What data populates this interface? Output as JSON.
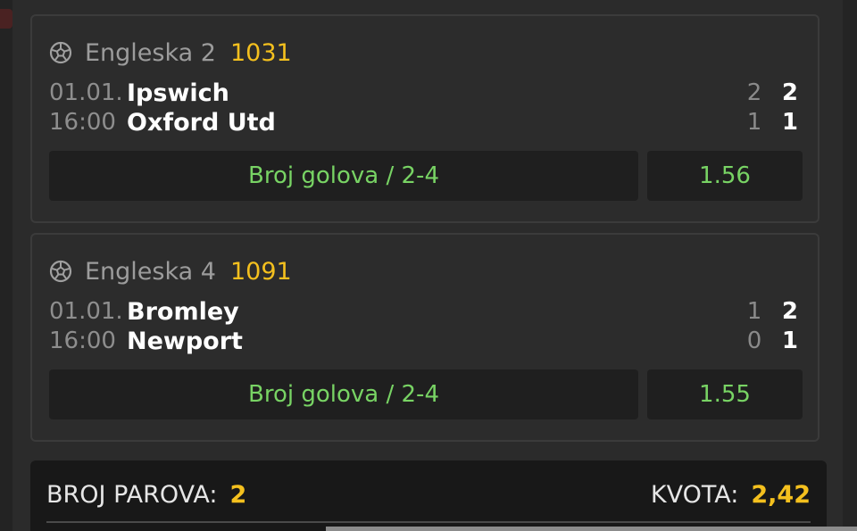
{
  "matches": [
    {
      "league": "Engleska 2",
      "code": "1031",
      "date": "01.01.",
      "time": "16:00",
      "home": "Ipswich",
      "away": "Oxford Utd",
      "home_half": "2",
      "home_final": "2",
      "away_half": "1",
      "away_final": "1",
      "pick": "Broj golova / 2-4",
      "odd": "1.56"
    },
    {
      "league": "Engleska 4",
      "code": "1091",
      "date": "01.01.",
      "time": "16:00",
      "home": "Bromley",
      "away": "Newport",
      "home_half": "1",
      "home_final": "2",
      "away_half": "0",
      "away_final": "1",
      "pick": "Broj golova / 2-4",
      "odd": "1.55"
    }
  ],
  "summary": {
    "pairs_label": "BROJ PAROVA:",
    "pairs_value": "2",
    "odds_label": "KVOTA:",
    "odds_value": "2,42"
  },
  "icons": {
    "league": "soccer-ball-icon"
  },
  "colors": {
    "accent_yellow": "#f4c01e",
    "pick_green": "#78d364",
    "card_bg": "#2c2c2c",
    "box_bg": "#1f1f1f",
    "summary_bg": "#181818"
  }
}
